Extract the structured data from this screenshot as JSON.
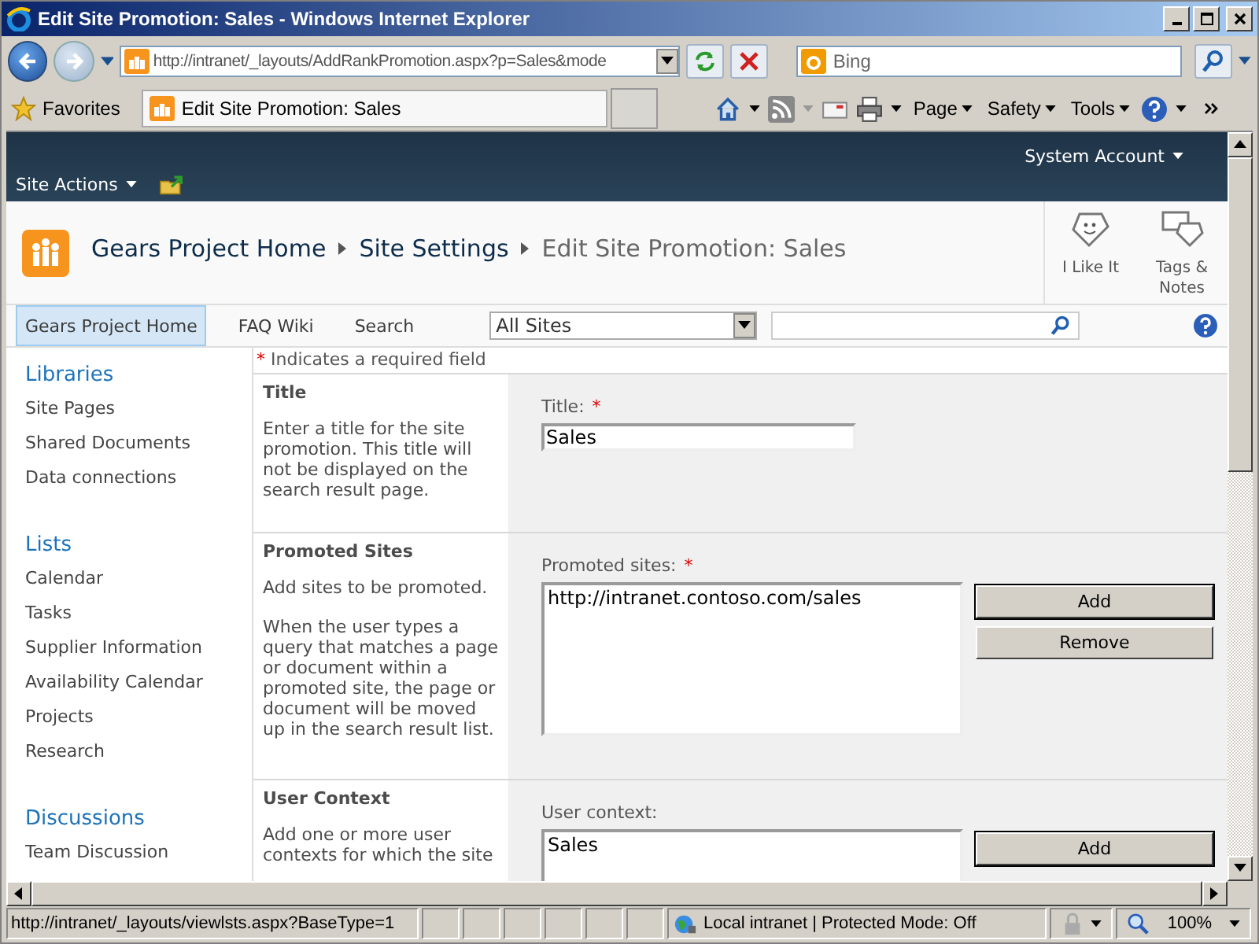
{
  "window": {
    "title": "Edit Site Promotion: Sales - Windows Internet Explorer"
  },
  "address_bar": {
    "url": "http://intranet/_layouts/AddRankPromotion.aspx?p=Sales&mode"
  },
  "search_box": {
    "placeholder": "Bing"
  },
  "favorites": {
    "label": "Favorites"
  },
  "tabs": [
    {
      "title": "Edit Site Promotion: Sales",
      "selected": true
    }
  ],
  "command_bar": [
    "Page",
    "Safety",
    "Tools"
  ],
  "ribbon": {
    "site_actions": "Site Actions",
    "account": "System Account"
  },
  "breadcrumb": [
    "Gears Project Home",
    "Site Settings",
    "Edit Site Promotion: Sales"
  ],
  "social": [
    {
      "label": "I Like It",
      "kind": "like"
    },
    {
      "label": "Tags & Notes",
      "kind": "tags"
    }
  ],
  "top_nav": {
    "items": [
      {
        "label": "Gears Project Home",
        "selected": true
      },
      {
        "label": "FAQ Wiki",
        "selected": false
      },
      {
        "label": "Search",
        "selected": false
      }
    ],
    "scope": "All Sites"
  },
  "quick_launch": [
    {
      "heading": "Libraries",
      "items": [
        "Site Pages",
        "Shared Documents",
        "Data connections"
      ]
    },
    {
      "heading": "Lists",
      "items": [
        "Calendar",
        "Tasks",
        "Supplier Information",
        "Availability Calendar",
        "Projects",
        "Research"
      ]
    },
    {
      "heading": "Discussions",
      "items": [
        "Team Discussion"
      ]
    }
  ],
  "required_note": {
    "mark": "*",
    "text": "Indicates a required field"
  },
  "sections": [
    {
      "title": "Title",
      "description": [
        "Enter a title for the site promotion. This title will not be displayed on the search result page."
      ],
      "field_label": "Title:",
      "required_mark": "*",
      "kind": "input",
      "value": "Sales"
    },
    {
      "title": "Promoted Sites",
      "description": [
        "Add sites to be promoted.",
        "When the user types a query that matches a page or document within a promoted site, the page or document will be moved up in the search result list."
      ],
      "field_label": "Promoted sites:",
      "required_mark": "*",
      "kind": "list",
      "value": "http://intranet.contoso.com/sales",
      "buttons": [
        "Add",
        "Remove"
      ]
    },
    {
      "title": "User Context",
      "description": [
        "Add one or more user contexts for which the site"
      ],
      "field_label": "User context:",
      "kind": "list",
      "value": "Sales",
      "buttons": [
        "Add"
      ]
    }
  ],
  "status_bar": {
    "url": "http://intranet/_layouts/viewlsts.aspx?BaseType=1",
    "zone": "Local intranet | Protected Mode: Off",
    "zoom": "100%"
  }
}
